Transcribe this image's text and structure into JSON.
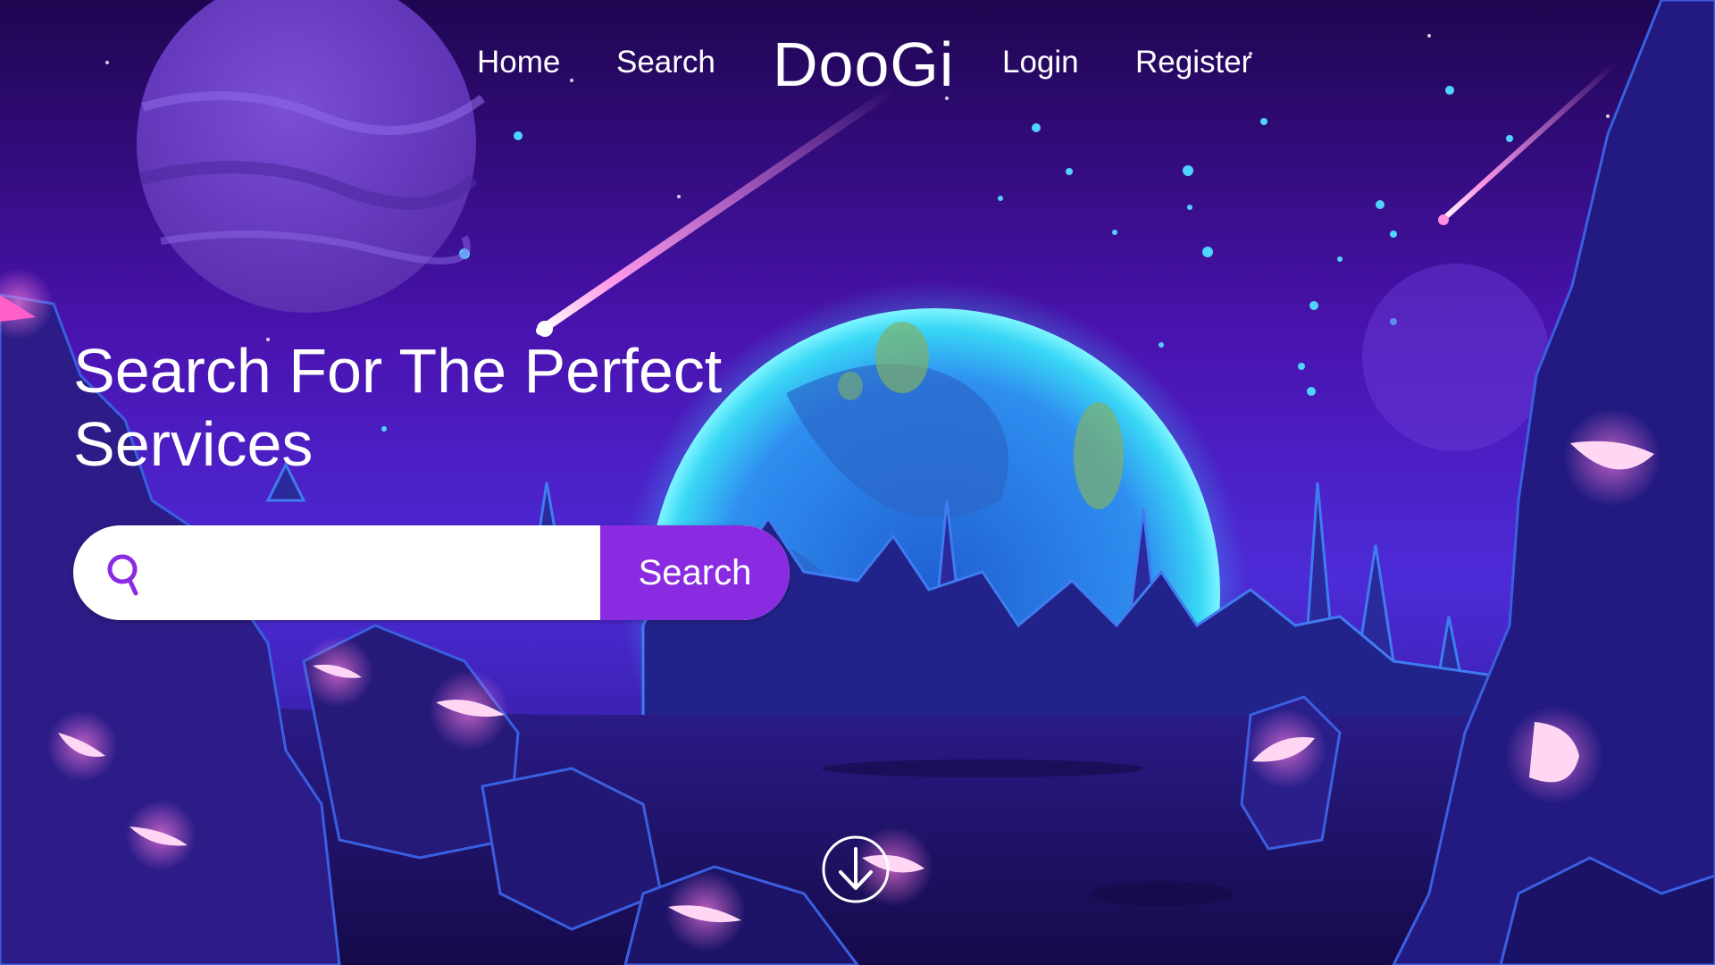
{
  "nav": {
    "home_label": "Home",
    "search_label": "Search",
    "brand": "DooGi",
    "login_label": "Login",
    "register_label": "Register"
  },
  "hero": {
    "title": "Search For The Perfect Services"
  },
  "search": {
    "placeholder": "",
    "value": "",
    "button_label": "Search",
    "icon": "search-icon"
  },
  "scroll": {
    "icon": "arrow-down-circle-icon"
  },
  "colors": {
    "accent": "#8a2be2",
    "sky_top": "#240a5c",
    "sky_mid": "#5a1cc8",
    "ground": "#1b1060",
    "planet_glow": "#38e8ff",
    "crystal": "#ff5fc8"
  }
}
